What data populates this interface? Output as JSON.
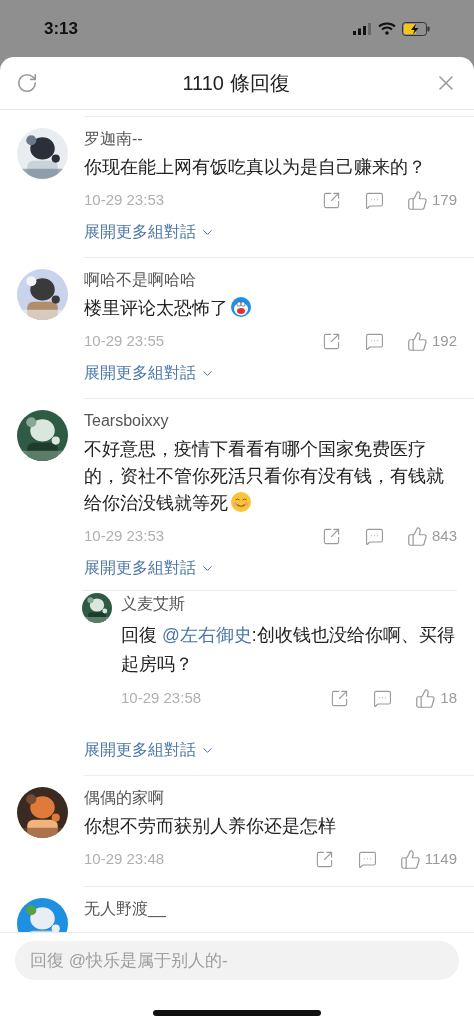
{
  "status_bar": {
    "time": "3:13"
  },
  "header": {
    "title": "1110 條回復"
  },
  "comments": [
    {
      "name": "罗迦南--",
      "text": "你现在能上网有饭吃真以为是自己赚来的？",
      "time": "10-29 23:53",
      "likes": "179",
      "expand_label": "展開更多組對話"
    },
    {
      "name": "啊哈不是啊哈哈",
      "text": "楼里评论太恐怖了",
      "emoji": {
        "kind": "robot-cat"
      },
      "time": "10-29 23:55",
      "likes": "192",
      "expand_label": "展開更多組對話"
    },
    {
      "name": "Tearsboixxy",
      "text": "不好意思，疫情下看看有哪个国家免费医疗的，资社不管你死活只看你有没有钱，有钱就给你治没钱就等死",
      "emoji": {
        "kind": "smile"
      },
      "time": "10-29 23:53",
      "likes": "843",
      "expand_label": "展開更多組對話",
      "replies": [
        {
          "name": "义麦艾斯",
          "prefix": "回復",
          "mention": "@左右御史",
          "text": ":创收钱也没给你啊、买得起房吗？",
          "time": "10-29 23:58",
          "likes": "18"
        }
      ],
      "replies_expand_label": "展開更多組對話"
    },
    {
      "name": "偶偶的家啊",
      "text": "你想不劳而获别人养你还是怎样",
      "time": "10-29 23:48",
      "likes": "1149"
    },
    {
      "name": "无人野渡__"
    }
  ],
  "reply_field": {
    "placeholder": "回復 @快乐是属于别人的-"
  }
}
